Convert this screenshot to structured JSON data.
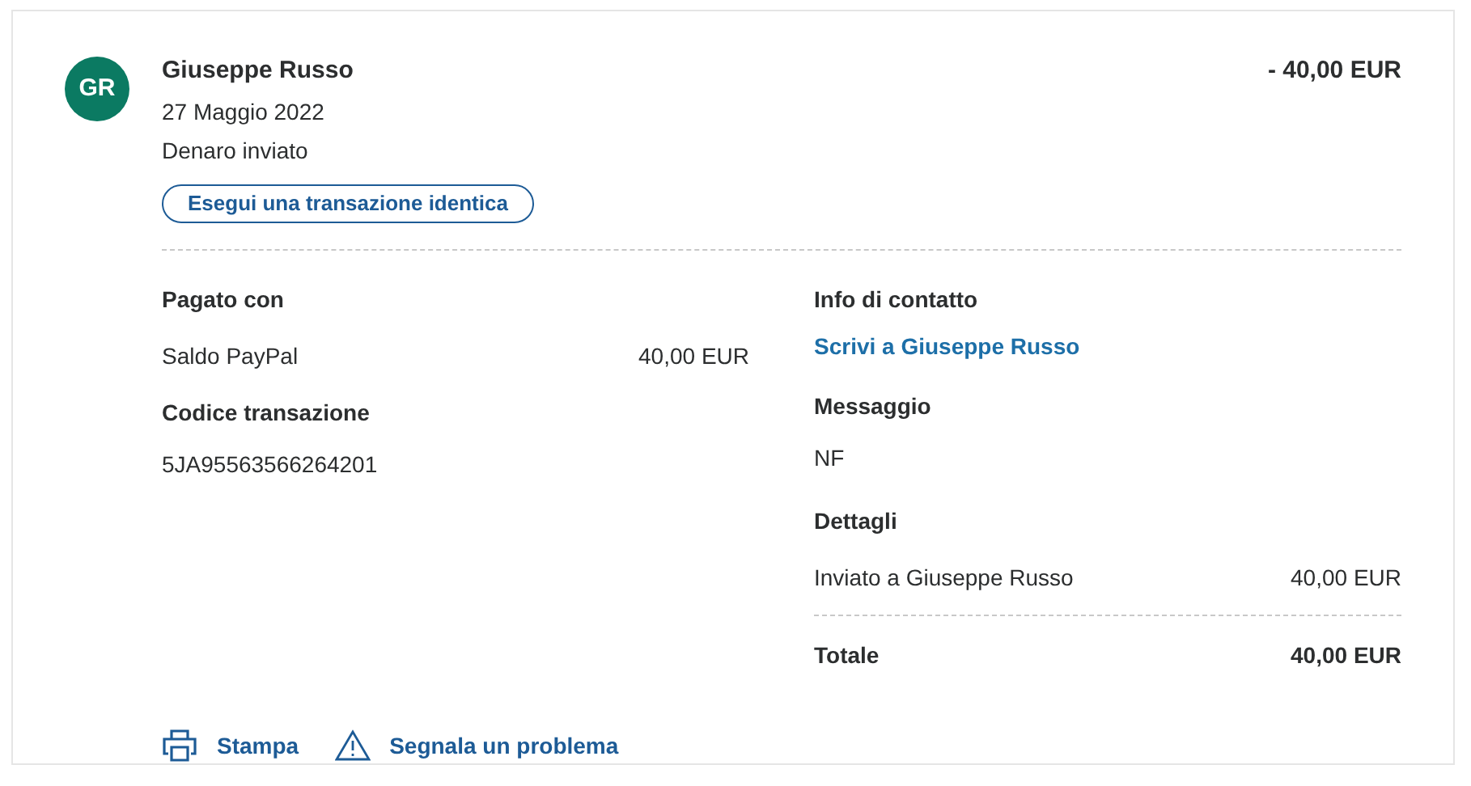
{
  "header": {
    "avatar": "GR",
    "name": "Giuseppe Russo",
    "date": "27 Maggio 2022",
    "status": "Denaro inviato",
    "amount": "- 40,00 EUR",
    "repeat_button": "Esegui una transazione identica"
  },
  "paid_with": {
    "title": "Pagato con",
    "method": "Saldo PayPal",
    "amount": "40,00 EUR"
  },
  "transaction_code": {
    "title": "Codice transazione",
    "value": "5JA95563566264201"
  },
  "contact": {
    "title": "Info di contatto",
    "link": "Scrivi a Giuseppe Russo"
  },
  "message": {
    "title": "Messaggio",
    "value": "NF"
  },
  "details": {
    "title": "Dettagli",
    "rows": [
      {
        "label": "Inviato a Giuseppe Russo",
        "amount": "40,00 EUR"
      }
    ],
    "total": {
      "label": "Totale",
      "amount": "40,00 EUR"
    }
  },
  "actions": [
    {
      "kind": "print",
      "label": "Stampa"
    },
    {
      "kind": "report",
      "label": "Segnala un problema"
    }
  ]
}
